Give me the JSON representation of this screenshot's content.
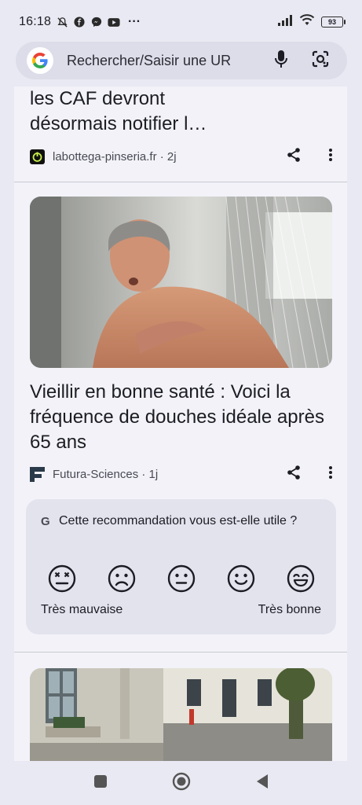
{
  "status_bar": {
    "time": "16:18",
    "battery": "93",
    "icons": [
      "muted-icon",
      "facebook-icon",
      "messenger-icon",
      "youtube-icon",
      "more-notifications-icon",
      "signal-icon",
      "wifi-icon",
      "battery-icon"
    ],
    "more": "···"
  },
  "search": {
    "placeholder": "Rechercher/Saisir une UR"
  },
  "cards": [
    {
      "title": "les CAF devront\ndésormais notifier l…",
      "source": "labottega-pinseria.fr · 2j"
    },
    {
      "title": "Vieillir en bonne santé : Voici la fréquence de douches idéale après 65 ans",
      "source": "Futura-Sciences · 1j"
    }
  ],
  "feedback": {
    "g": "G",
    "question": "Cette recommandation vous est-elle utile ?",
    "low_label": "Très mauvaise",
    "high_label": "Très bonne",
    "faces": [
      "very-bad-face-icon",
      "bad-face-icon",
      "neutral-face-icon",
      "good-face-icon",
      "very-good-face-icon"
    ]
  },
  "colors": {
    "background": "#e9e9f3",
    "feed": "#f2f2f8",
    "feedback_card": "#e3e3ee",
    "search_bar": "#dcdde9"
  }
}
